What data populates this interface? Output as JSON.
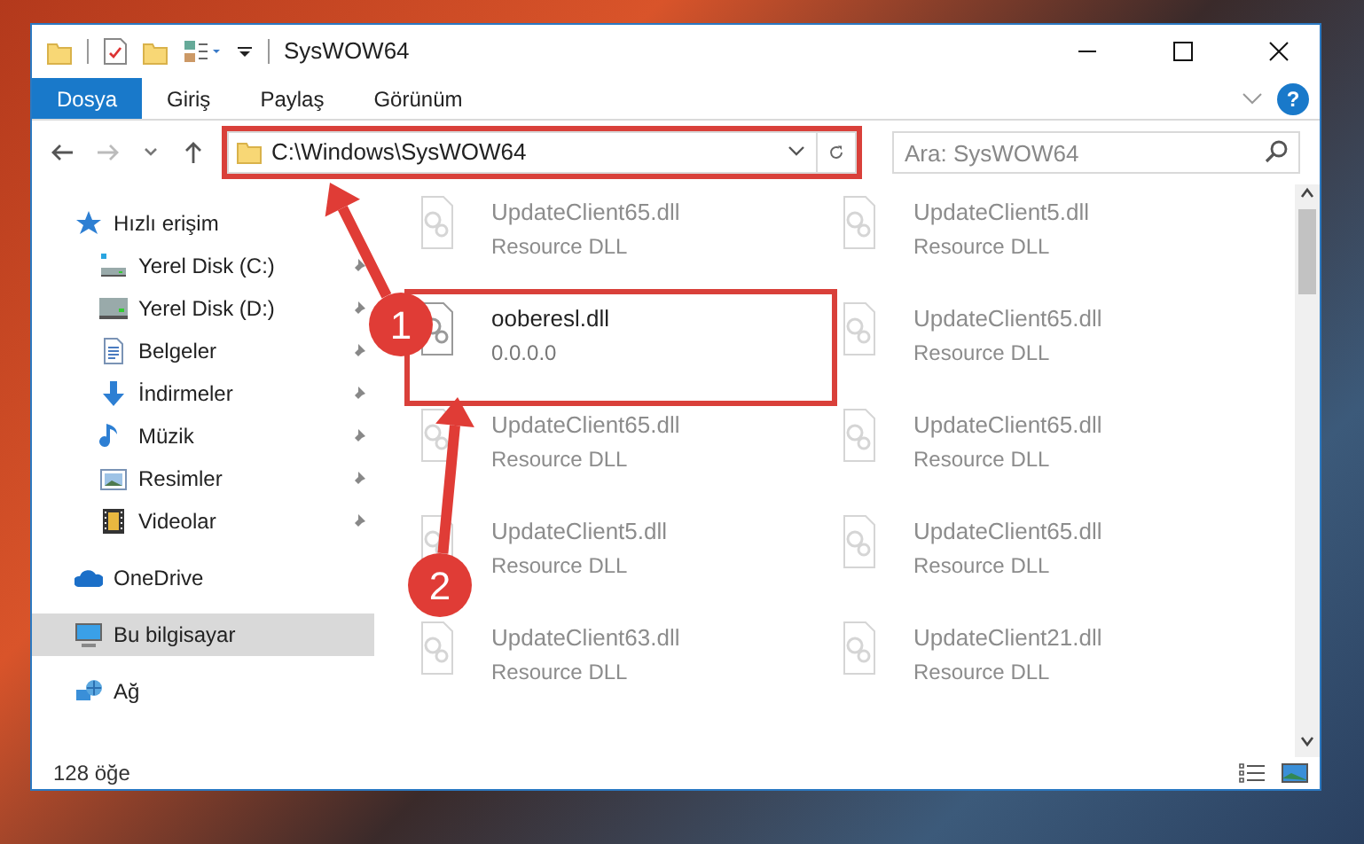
{
  "window": {
    "title": "SysWOW64"
  },
  "ribbon": {
    "tabs": [
      {
        "label": "Dosya",
        "selected": true
      },
      {
        "label": "Giriş",
        "selected": false
      },
      {
        "label": "Paylaş",
        "selected": false
      },
      {
        "label": "Görünüm",
        "selected": false
      }
    ],
    "help": "?"
  },
  "address_bar": {
    "path": "C:\\Windows\\SysWOW64",
    "highlighted": true
  },
  "search": {
    "placeholder": "Ara: SysWOW64"
  },
  "sidebar": {
    "items": [
      {
        "label": "Hızlı erişim",
        "kind": "star",
        "selected": false,
        "children": [
          {
            "label": "Yerel Disk (C:)",
            "kind": "drive-system",
            "pinned": true,
            "selected": false
          },
          {
            "label": "Yerel Disk (D:)",
            "kind": "drive",
            "pinned": true,
            "selected": false
          },
          {
            "label": "Belgeler",
            "kind": "document",
            "pinned": true,
            "selected": false
          },
          {
            "label": "İndirmeler",
            "kind": "download",
            "pinned": true,
            "selected": false
          },
          {
            "label": "Müzik",
            "kind": "music",
            "pinned": true,
            "selected": false
          },
          {
            "label": "Resimler",
            "kind": "picture",
            "pinned": true,
            "selected": false
          },
          {
            "label": "Videolar",
            "kind": "video",
            "pinned": true,
            "selected": false
          }
        ]
      },
      {
        "label": "OneDrive",
        "kind": "cloud",
        "selected": false
      },
      {
        "label": "Bu bilgisayar",
        "kind": "computer",
        "selected": true
      },
      {
        "label": "Ağ",
        "kind": "network",
        "selected": false
      }
    ]
  },
  "files": [
    {
      "name": "UpdateClient65.dll",
      "description": "Resource DLL",
      "faded": true,
      "highlighted": false
    },
    {
      "name": "UpdateClient5.dll",
      "description": "Resource DLL",
      "faded": true,
      "highlighted": false
    },
    {
      "name": "ooberesl.dll",
      "description": "0.0.0.0",
      "faded": false,
      "highlighted": true
    },
    {
      "name": "UpdateClient65.dll",
      "description": "Resource DLL",
      "faded": true,
      "highlighted": false
    },
    {
      "name": "UpdateClient65.dll",
      "description": "Resource DLL",
      "faded": true,
      "highlighted": false
    },
    {
      "name": "UpdateClient65.dll",
      "description": "Resource DLL",
      "faded": true,
      "highlighted": false
    },
    {
      "name": "UpdateClient5.dll",
      "description": "Resource DLL",
      "faded": true,
      "highlighted": false
    },
    {
      "name": "UpdateClient65.dll",
      "description": "Resource DLL",
      "faded": true,
      "highlighted": false
    },
    {
      "name": "UpdateClient63.dll",
      "description": "Resource DLL",
      "faded": true,
      "highlighted": false
    },
    {
      "name": "UpdateClient21.dll",
      "description": "Resource DLL",
      "faded": true,
      "highlighted": false
    }
  ],
  "status_bar": {
    "item_count": "128 öğe"
  },
  "annotations": [
    {
      "number": "1"
    },
    {
      "number": "2"
    }
  ]
}
